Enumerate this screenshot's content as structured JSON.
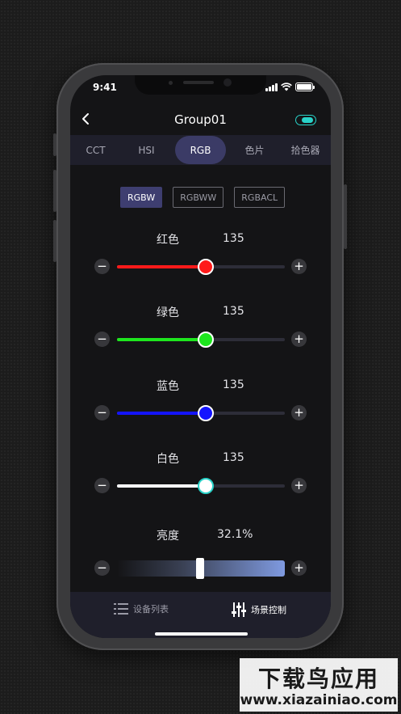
{
  "status_bar": {
    "time": "9:41"
  },
  "header": {
    "title": "Group01",
    "back_icon": "chevron-left-icon",
    "power_toggle": "on"
  },
  "tabs": [
    {
      "label": "CCT",
      "active": false
    },
    {
      "label": "HSI",
      "active": false
    },
    {
      "label": "RGB",
      "active": true
    },
    {
      "label": "色片",
      "active": false
    },
    {
      "label": "拾色器",
      "active": false
    }
  ],
  "modes": [
    {
      "label": "RGBW",
      "active": true
    },
    {
      "label": "RGBWW",
      "active": false
    },
    {
      "label": "RGBACL",
      "active": false
    }
  ],
  "channels": [
    {
      "label": "红色",
      "value": "135",
      "fraction": 0.5294,
      "color": "#ff1a1a"
    },
    {
      "label": "绿色",
      "value": "135",
      "fraction": 0.5294,
      "color": "#1ee61e"
    },
    {
      "label": "蓝色",
      "value": "135",
      "fraction": 0.5294,
      "color": "#1414ff"
    },
    {
      "label": "白色",
      "value": "135",
      "fraction": 0.5294,
      "color": "#ffffff"
    }
  ],
  "brightness": {
    "label": "亮度",
    "value": "32.1%",
    "fraction": 0.321
  },
  "bottom_nav": [
    {
      "label": "设备列表",
      "icon": "list-icon",
      "active": false
    },
    {
      "label": "场景控制",
      "icon": "sliders-icon",
      "active": true
    }
  ],
  "watermark": {
    "main": "下载鸟应用",
    "sub": "www.xiazainiao.com"
  },
  "colors": {
    "accent": "#29d3c9",
    "tab_active": "#3b3b66",
    "mode_active": "#3e3e70",
    "background": "#141416"
  }
}
